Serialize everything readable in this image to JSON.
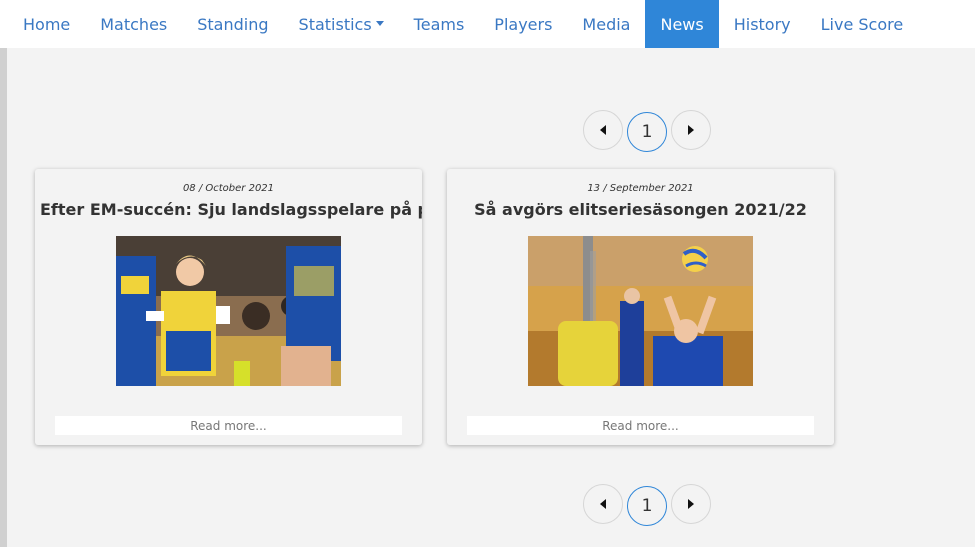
{
  "nav": {
    "items": [
      {
        "label": "Home"
      },
      {
        "label": "Matches"
      },
      {
        "label": "Standing"
      },
      {
        "label": "Statistics"
      },
      {
        "label": "Teams"
      },
      {
        "label": "Players"
      },
      {
        "label": "Media"
      },
      {
        "label": "News"
      },
      {
        "label": "History"
      },
      {
        "label": "Live Score"
      }
    ],
    "active": "News",
    "accent_color": "#2f86d8",
    "link_color": "#3a78c3"
  },
  "pagination": {
    "current_page": "1",
    "prev_icon": "caret-left-icon",
    "next_icon": "caret-right-icon"
  },
  "news": [
    {
      "date": "08 / October 2021",
      "title": "Efter EM-succén: Sju landslagsspelare på planen",
      "read_more": "Read more..."
    },
    {
      "date": "13 / September 2021",
      "title": "Så avgörs elitseriesäsongen 2021/22",
      "read_more": "Read more..."
    }
  ]
}
